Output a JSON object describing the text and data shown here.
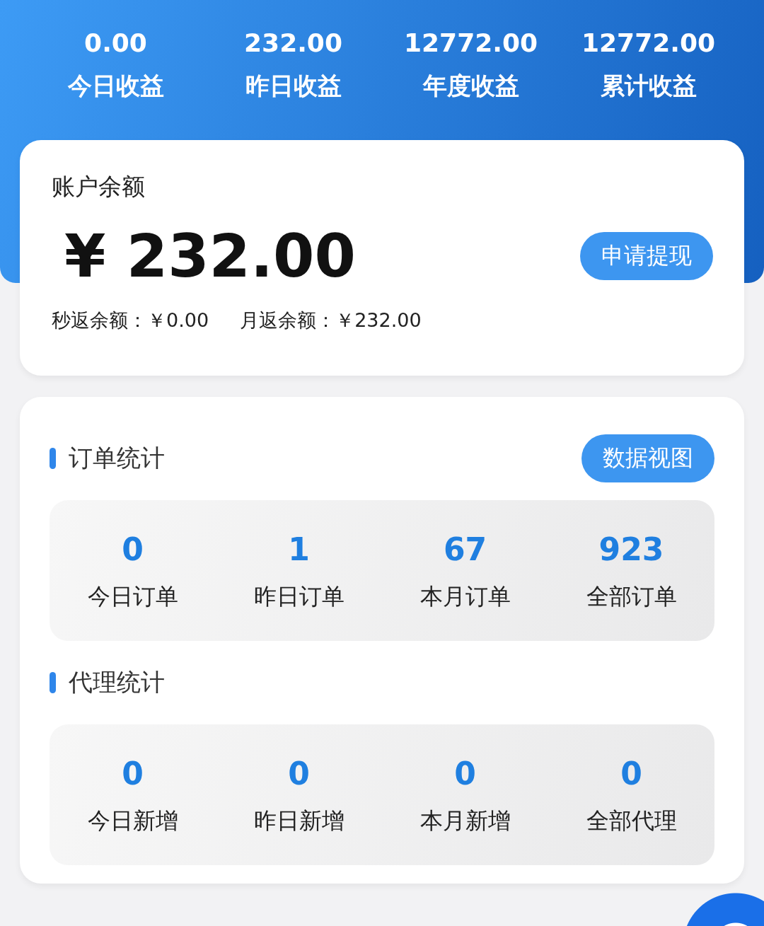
{
  "earnings": [
    {
      "value": "0.00",
      "label": "今日收益"
    },
    {
      "value": "232.00",
      "label": "昨日收益"
    },
    {
      "value": "12772.00",
      "label": "年度收益"
    },
    {
      "value": "12772.00",
      "label": "累计收益"
    }
  ],
  "balance": {
    "title": "账户余额",
    "amount": "¥ 232.00",
    "button": "申请提现",
    "details": [
      "秒返余额：￥0.00",
      "月返余额：￥232.00"
    ]
  },
  "sections": [
    {
      "title": "订单统计",
      "button": "数据视图",
      "stats": [
        {
          "value": "0",
          "label": "今日订单"
        },
        {
          "value": "1",
          "label": "昨日订单"
        },
        {
          "value": "67",
          "label": "本月订单"
        },
        {
          "value": "923",
          "label": "全部订单"
        }
      ]
    },
    {
      "title": "代理统计",
      "stats": [
        {
          "value": "0",
          "label": "今日新增"
        },
        {
          "value": "0",
          "label": "昨日新增"
        },
        {
          "value": "0",
          "label": "本月新增"
        },
        {
          "value": "0",
          "label": "全部代理"
        }
      ]
    }
  ]
}
